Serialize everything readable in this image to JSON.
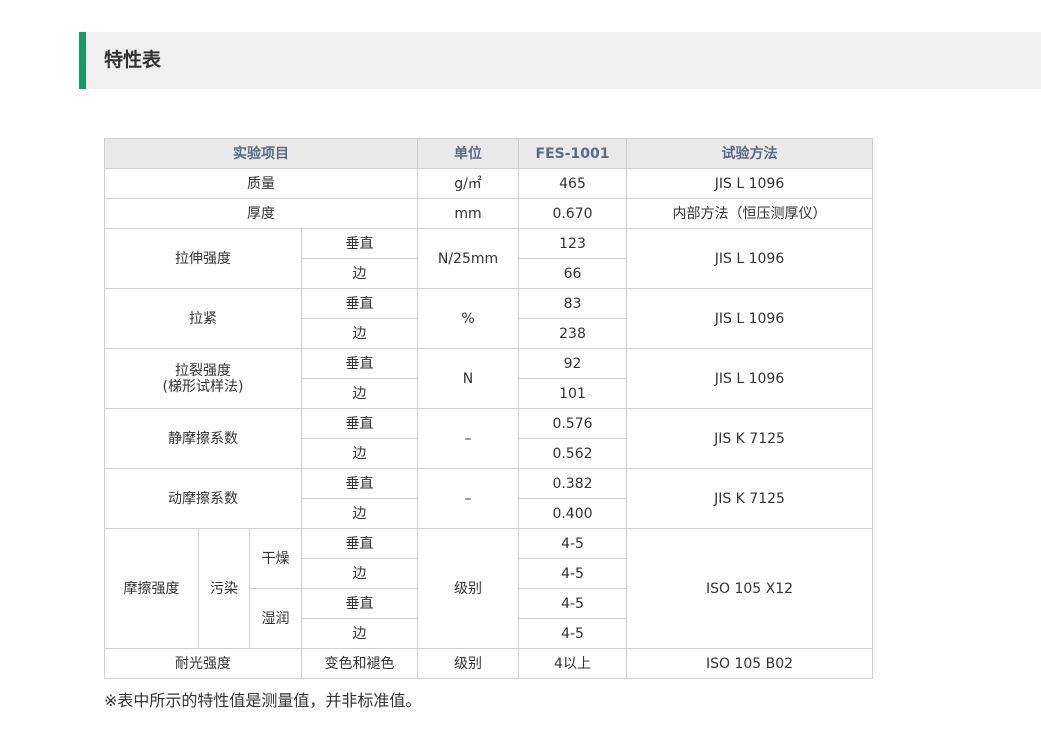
{
  "section": {
    "title": "特性表"
  },
  "table": {
    "headers": {
      "item": "实验项目",
      "unit": "单位",
      "product": "FES-1001",
      "method": "试验方法"
    },
    "rows": {
      "mass": {
        "label": "质量",
        "unit": "g/㎡",
        "value": "465",
        "method": "JIS L 1096"
      },
      "thickness": {
        "label": "厚度",
        "unit": "mm",
        "value": "0.670",
        "method": "内部方法（恒压测厚仪）"
      },
      "tensile": {
        "label": "拉伸强度",
        "dir1": "垂直",
        "dir2": "边",
        "unit": "N/25mm",
        "value1": "123",
        "value2": "66",
        "method": "JIS L 1096"
      },
      "elongation": {
        "label": "拉紧",
        "dir1": "垂直",
        "dir2": "边",
        "unit": "%",
        "value1": "83",
        "value2": "238",
        "method": "JIS L 1096"
      },
      "tear": {
        "label": "拉裂强度",
        "sublabel": "(梯形试样法)",
        "dir1": "垂直",
        "dir2": "边",
        "unit": "N",
        "value1": "92",
        "value2": "101",
        "method": "JIS L 1096"
      },
      "static_friction": {
        "label": "静摩擦系数",
        "dir1": "垂直",
        "dir2": "边",
        "unit": "–",
        "value1": "0.576",
        "value2": "0.562",
        "method": "JIS K 7125"
      },
      "dynamic_friction": {
        "label": "动摩擦系数",
        "dir1": "垂直",
        "dir2": "边",
        "unit": "–",
        "value1": "0.382",
        "value2": "0.400",
        "method": "JIS K 7125"
      },
      "rub_fastness": {
        "label": "摩擦强度",
        "stain": "污染",
        "dry": "干燥",
        "wet": "湿润",
        "dir1": "垂直",
        "dir2": "边",
        "unit": "级别",
        "dry_value1": "4-5",
        "dry_value2": "4-5",
        "wet_value1": "4-5",
        "wet_value2": "4-5",
        "method": "ISO 105 X12"
      },
      "light_fastness": {
        "label": "耐光强度",
        "sub": "变色和褪色",
        "unit": "级别",
        "value": "4以上",
        "method": "ISO 105 B02"
      }
    }
  },
  "note": "※表中所示的特性值是测量值，并非标准值。"
}
